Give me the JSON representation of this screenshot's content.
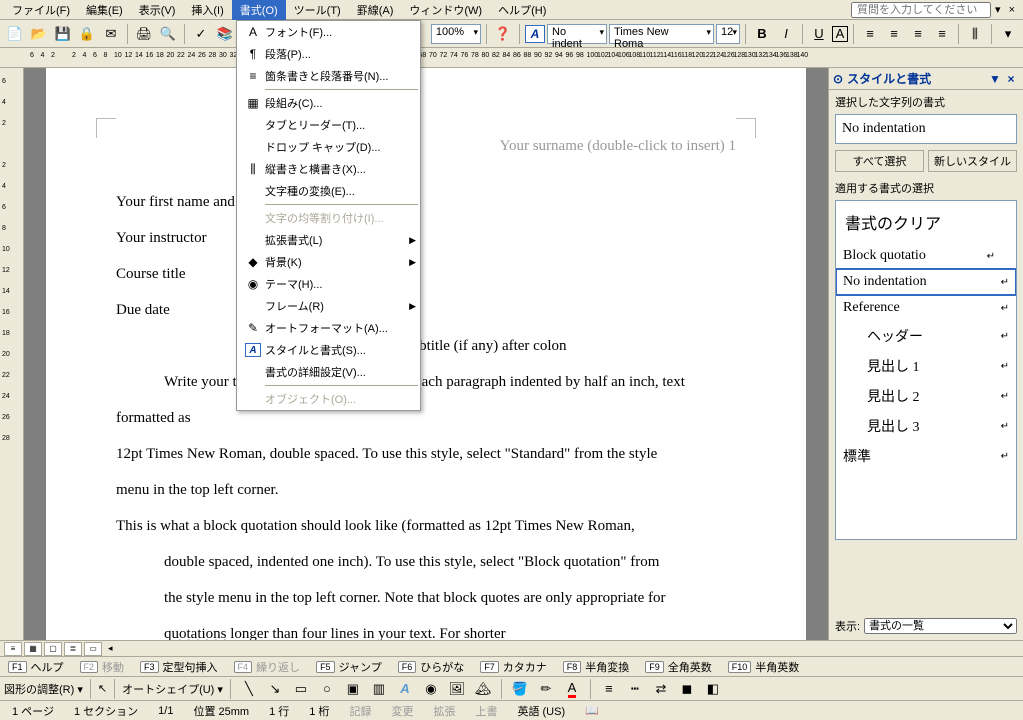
{
  "menubar": {
    "items": [
      "ファイル(F)",
      "編集(E)",
      "表示(V)",
      "挿入(I)",
      "書式(O)",
      "ツール(T)",
      "罫線(A)",
      "ウィンドウ(W)",
      "ヘルプ(H)"
    ],
    "active_index": 4,
    "help_placeholder": "質問を入力してください"
  },
  "toolbar": {
    "zoom": "100%",
    "style_name": "No indent",
    "font_name": "Times New Roma",
    "font_size": "12"
  },
  "dropdown": {
    "items": [
      {
        "icon": "A",
        "label": "フォント(F)...",
        "type": "item"
      },
      {
        "icon": "¶",
        "label": "段落(P)...",
        "type": "item"
      },
      {
        "icon": "≡",
        "label": "箇条書きと段落番号(N)...",
        "type": "item"
      },
      {
        "type": "sep"
      },
      {
        "icon": "▦",
        "label": "段組み(C)...",
        "type": "item"
      },
      {
        "icon": "",
        "label": "タブとリーダー(T)...",
        "type": "item"
      },
      {
        "icon": "",
        "label": "ドロップ キャップ(D)...",
        "type": "item"
      },
      {
        "icon": "⫼",
        "label": "縦書きと横書き(X)...",
        "type": "item"
      },
      {
        "icon": "",
        "label": "文字種の変換(E)...",
        "type": "item"
      },
      {
        "type": "sep"
      },
      {
        "icon": "",
        "label": "文字の均等割り付け(I)...",
        "type": "item",
        "disabled": true
      },
      {
        "icon": "",
        "label": "拡張書式(L)",
        "type": "sub"
      },
      {
        "icon": "◆",
        "label": "背景(K)",
        "type": "sub"
      },
      {
        "icon": "◉",
        "label": "テーマ(H)...",
        "type": "item"
      },
      {
        "icon": "",
        "label": "フレーム(R)",
        "type": "sub"
      },
      {
        "icon": "✎",
        "label": "オートフォーマット(A)...",
        "type": "item"
      },
      {
        "icon": "A",
        "label": "スタイルと書式(S)...",
        "type": "item",
        "hl": true
      },
      {
        "icon": "",
        "label": "書式の詳細設定(V)...",
        "type": "item"
      },
      {
        "type": "sep"
      },
      {
        "icon": "",
        "label": "オブジェクト(O)...",
        "type": "item",
        "disabled": true
      }
    ]
  },
  "document": {
    "header": "Your surname (double-click to insert) 1",
    "lines": [
      {
        "text": "Your first name and surname",
        "cls": ""
      },
      {
        "text": "Your instructor",
        "cls": ""
      },
      {
        "text": "Course title",
        "cls": ""
      },
      {
        "text": "Due date",
        "cls": ""
      },
      {
        "text": "Title of your paper: subtitle (if any) after colon",
        "cls": "center"
      },
      {
        "text": "Write your text here, with the first line of each paragraph indented by half an inch, text formatted as",
        "cls": "indent1"
      },
      {
        "text": "12pt Times New Roman, double spaced. To use this style, select \"Standard\" from the style",
        "cls": ""
      },
      {
        "text": "menu in the top left corner.",
        "cls": ""
      },
      {
        "text": "This is what a block quotation should look like (formatted as 12pt Times New Roman,",
        "cls": ""
      },
      {
        "text": "double spaced, indented one inch). To use this style, select \"Block quotation\" from",
        "cls": "indent2"
      },
      {
        "text": "the style menu in the top left corner. Note that block quotes are only appropriate for",
        "cls": "indent2"
      },
      {
        "text": "quotations longer than four lines in your text. For shorter quotations, use in-line",
        "cls": "indent2",
        "wavy": "quotations"
      }
    ]
  },
  "sidepanel": {
    "title": "スタイルと書式",
    "section1_label": "選択した文字列の書式",
    "current_style": "No indentation",
    "btn_select_all": "すべて選択",
    "btn_new_style": "新しいスタイル",
    "section2_label": "適用する書式の選択",
    "items": [
      {
        "label": "書式のクリア",
        "cls": "clear"
      },
      {
        "label": "Block quotatio",
        "cls": "right",
        "ret": true
      },
      {
        "label": "No indentation",
        "cls": "sel",
        "ret": true
      },
      {
        "label": "Reference",
        "cls": "",
        "ret": true
      },
      {
        "label": "ヘッダー",
        "cls": "indent",
        "ret": true
      },
      {
        "label": "見出し 1",
        "cls": "indent",
        "ret": true
      },
      {
        "label": "見出し 2",
        "cls": "indent",
        "ret": true
      },
      {
        "label": "見出し 3",
        "cls": "indent",
        "ret": true
      },
      {
        "label": "標準",
        "cls": "",
        "ret": true
      }
    ],
    "footer_label": "表示:",
    "footer_select": "書式の一覧"
  },
  "fnbar": [
    {
      "key": "F1",
      "label": "ヘルプ"
    },
    {
      "key": "F2",
      "label": "移動",
      "dis": true
    },
    {
      "key": "F3",
      "label": "定型句挿入"
    },
    {
      "key": "F4",
      "label": "繰り返し",
      "dis": true
    },
    {
      "key": "F5",
      "label": "ジャンプ"
    },
    {
      "key": "F6",
      "label": "ひらがな"
    },
    {
      "key": "F7",
      "label": "カタカナ"
    },
    {
      "key": "F8",
      "label": "半角変換"
    },
    {
      "key": "F9",
      "label": "全角英数"
    },
    {
      "key": "F10",
      "label": "半角英数"
    }
  ],
  "drawbar": {
    "label": "図形の調整(R)",
    "autoshape": "オートシェイプ(U)"
  },
  "statusbar": {
    "page": "1 ページ",
    "section": "1 セクション",
    "pages": "1/1",
    "pos": "位置 25mm",
    "line": "1 行",
    "col": "1 桁",
    "rec": "記録",
    "trk": "変更",
    "ext": "拡張",
    "ovr": "上書",
    "lang": "英語 (US)"
  },
  "hruler_ticks": [
    "6",
    "4",
    "2",
    "",
    "2",
    "4",
    "6",
    "8",
    "10",
    "12",
    "14",
    "16",
    "18",
    "20",
    "22",
    "24",
    "26",
    "28",
    "30",
    "32",
    "34",
    "36",
    "38",
    "40",
    "42",
    "44",
    "46",
    "48",
    "50",
    "52",
    "54",
    "56",
    "58",
    "60",
    "62",
    "64",
    "66",
    "68",
    "70",
    "72",
    "74",
    "76",
    "78",
    "80",
    "82",
    "84",
    "86",
    "88",
    "90",
    "92",
    "94",
    "96",
    "98",
    "100",
    "102",
    "104",
    "106",
    "108",
    "110",
    "112",
    "114",
    "116",
    "118",
    "120",
    "122",
    "124",
    "126",
    "128",
    "130",
    "132",
    "134",
    "136",
    "138",
    "140"
  ],
  "vruler_ticks": [
    "6",
    "4",
    "2",
    "",
    "2",
    "4",
    "6",
    "8",
    "10",
    "12",
    "14",
    "16",
    "18",
    "20",
    "22",
    "24",
    "26",
    "28"
  ]
}
